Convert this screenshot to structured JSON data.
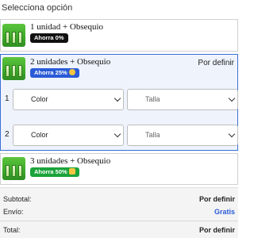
{
  "heading": "Selecciona opción",
  "offers": [
    {
      "title": "1 unidad + Obsequio",
      "badge": "Ahorra 0%",
      "badge_color": "#111111"
    },
    {
      "title": "2 unidades + Obsequio",
      "badge": "Ahorra 25%",
      "badge_color": "#2a5bd7",
      "price": "Por definir"
    },
    {
      "title": "3 unidades + Obsequio",
      "badge": "Ahorra 50%",
      "badge_color": "#1aa33a"
    }
  ],
  "variant_rows": [
    {
      "number": "1",
      "color": "Color",
      "size": "Talla"
    },
    {
      "number": "2",
      "color": "Color",
      "size": "Talla"
    }
  ],
  "summary": {
    "subtotal_label": "Subtotal:",
    "subtotal_value": "Por definir",
    "shipping_label": "Envío:",
    "shipping_value": "Gratis",
    "total_label": "Total:",
    "total_value": "Por definir"
  },
  "colors": {
    "accent": "#2a5bd7",
    "selected_bg": "#eef3fc",
    "selected_border": "#3b6fd8"
  }
}
